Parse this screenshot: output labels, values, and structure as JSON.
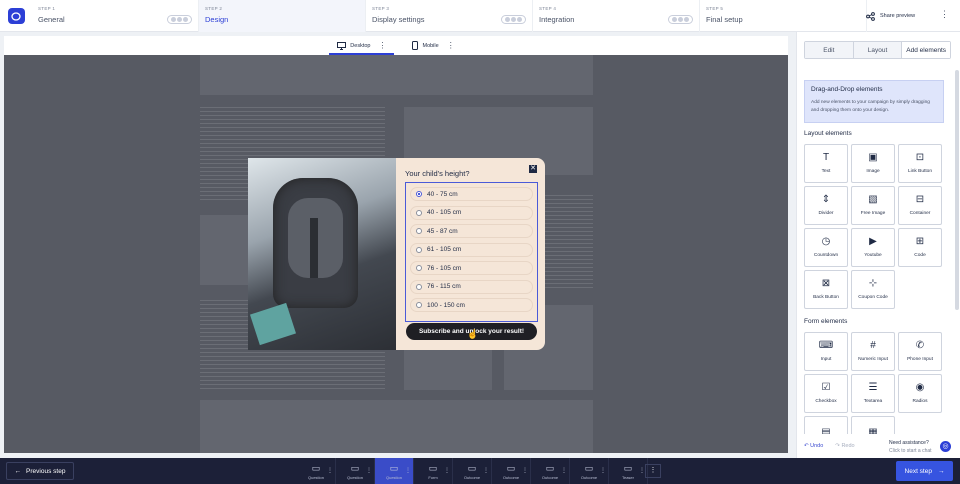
{
  "steps": [
    {
      "num": "STEP 1",
      "name": "General"
    },
    {
      "num": "STEP 2",
      "name": "Design"
    },
    {
      "num": "STEP 3",
      "name": "Display settings"
    },
    {
      "num": "STEP 4",
      "name": "Integration"
    },
    {
      "num": "STEP 5",
      "name": "Final setup"
    }
  ],
  "header": {
    "share_label": "Share preview"
  },
  "devices": {
    "desktop": "Desktop",
    "mobile": "Mobile"
  },
  "popup": {
    "question": "Your child's height?",
    "options": [
      "40 - 75 cm",
      "40 - 105 cm",
      "45 - 87 cm",
      "61 - 105 cm",
      "76 - 105 cm",
      "76 - 115 cm",
      "100 - 150 cm"
    ],
    "selected_index": 0,
    "cta": "Subscribe and unlock your result!"
  },
  "sidebar": {
    "tabs": [
      "Edit",
      "Layout",
      "Add elements"
    ],
    "info_title": "Drag-and-Drop elements",
    "info_text": "Add new elements to your campaign by simply dragging and dropping them onto your design.",
    "layout_title": "Layout elements",
    "layout_items": [
      {
        "label": "Text",
        "icon": "text-icon"
      },
      {
        "label": "Image",
        "icon": "image-icon"
      },
      {
        "label": "Link Button",
        "icon": "link-button-icon"
      },
      {
        "label": "Divider",
        "icon": "divider-icon"
      },
      {
        "label": "Free Image",
        "icon": "free-image-icon"
      },
      {
        "label": "Container",
        "icon": "container-icon"
      },
      {
        "label": "Countdown",
        "icon": "countdown-icon"
      },
      {
        "label": "Youtube",
        "icon": "youtube-icon"
      },
      {
        "label": "Code",
        "icon": "code-icon"
      },
      {
        "label": "Back Button",
        "icon": "back-button-icon"
      },
      {
        "label": "Coupon Code",
        "icon": "coupon-code-icon"
      }
    ],
    "form_title": "Form elements",
    "form_items": [
      {
        "label": "Input",
        "icon": "input-icon"
      },
      {
        "label": "Numeric Input",
        "icon": "numeric-input-icon"
      },
      {
        "label": "Phone Input",
        "icon": "phone-input-icon"
      },
      {
        "label": "Checkbox",
        "icon": "checkbox-icon"
      },
      {
        "label": "Textarea",
        "icon": "textarea-icon"
      },
      {
        "label": "Radios",
        "icon": "radios-icon"
      },
      {
        "label": "",
        "icon": "dropdown-icon"
      },
      {
        "label": "",
        "icon": "date-icon"
      }
    ],
    "undo": "Undo",
    "redo": "Redo",
    "help_title": "Need assistance?",
    "help_sub": "Click to start a chat"
  },
  "footer": {
    "prev": "Previous step",
    "next": "Next step",
    "pages": [
      {
        "label": "Question",
        "num": "1"
      },
      {
        "label": "Question",
        "num": "2"
      },
      {
        "label": "Question",
        "num": "3",
        "active": true
      },
      {
        "label": "Form",
        "num": ""
      },
      {
        "label": "Outcome",
        "num": "1"
      },
      {
        "label": "Outcome",
        "num": "2"
      },
      {
        "label": "Outcome",
        "num": "3"
      },
      {
        "label": "Outcome",
        "num": "4"
      },
      {
        "label": "Teaser",
        "num": ""
      }
    ]
  },
  "colors": {
    "accent": "#2c3fd6",
    "canvas": "#575a63",
    "popup_bg": "#f5e6d8",
    "footer_bg": "#1c2038"
  }
}
